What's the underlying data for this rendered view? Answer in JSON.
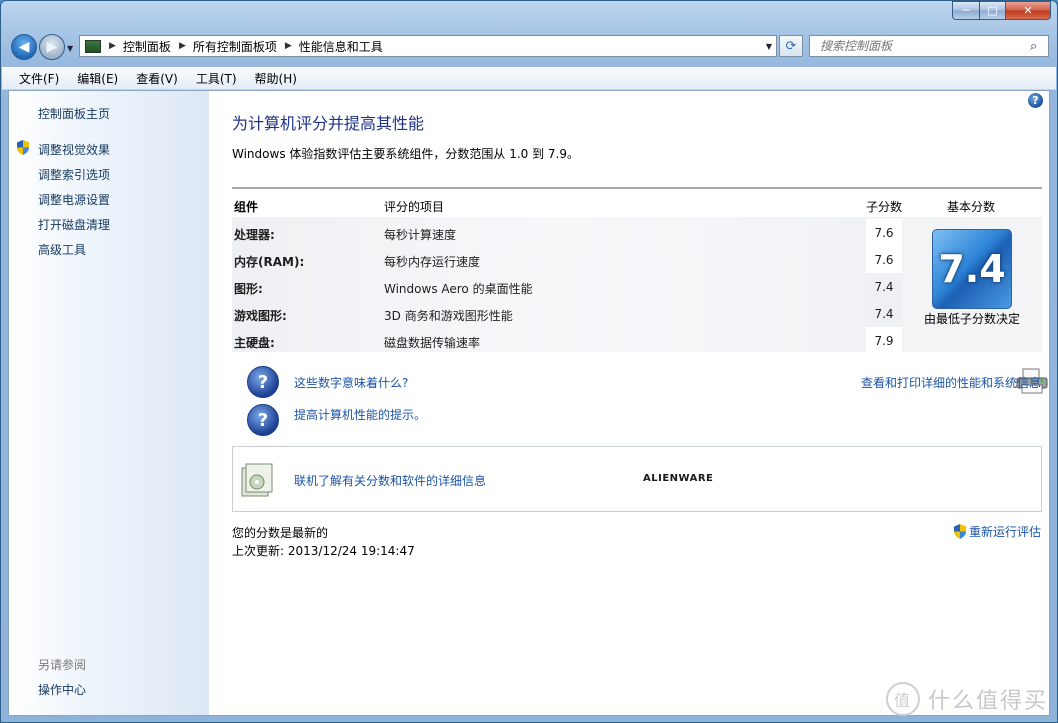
{
  "window": {
    "controls": {
      "minimize": "─",
      "maximize": "□",
      "close": "✕"
    }
  },
  "address": {
    "breadcrumbs": [
      "控制面板",
      "所有控制面板项",
      "性能信息和工具"
    ],
    "search_placeholder": "搜索控制面板"
  },
  "menu": [
    "文件(F)",
    "编辑(E)",
    "查看(V)",
    "工具(T)",
    "帮助(H)"
  ],
  "sidebar": {
    "home": "控制面板主页",
    "links": [
      "调整视觉效果",
      "调整索引选项",
      "调整电源设置",
      "打开磁盘清理",
      "高级工具"
    ],
    "see_also_heading": "另请参阅",
    "see_also_links": [
      "操作中心"
    ]
  },
  "main": {
    "title": "为计算机评分并提高其性能",
    "description": "Windows 体验指数评估主要系统组件，分数范围从 1.0 到 7.9。",
    "table": {
      "headers": {
        "component": "组件",
        "rated_item": "评分的项目",
        "subscore": "子分数",
        "base_score": "基本分数"
      },
      "rows": [
        {
          "component": "处理器:",
          "item": "每秒计算速度",
          "score": "7.6"
        },
        {
          "component": "内存(RAM):",
          "item": "每秒内存运行速度",
          "score": "7.6"
        },
        {
          "component": "图形:",
          "item": "Windows Aero 的桌面性能",
          "score": "7.4"
        },
        {
          "component": "游戏图形:",
          "item": "3D 商务和游戏图形性能",
          "score": "7.4"
        },
        {
          "component": "主硬盘:",
          "item": "磁盘数据传输速率",
          "score": "7.9"
        }
      ],
      "base_score": "7.4",
      "base_caption": "由最低子分数决定"
    },
    "links": {
      "what_mean": "这些数字意味着什么?",
      "tips": "提高计算机性能的提示。",
      "print_details": "查看和打印详细的性能和系统信息",
      "online": "联机了解有关分数和软件的详细信息"
    },
    "brand": "ALIENWARE",
    "status": {
      "current": "您的分数是最新的",
      "last_update": "上次更新: 2013/12/24 19:14:47",
      "rerun": "重新运行评估"
    },
    "help_glyph": "?"
  },
  "watermark": {
    "text": "什么值得买",
    "icon_glyph": "值"
  }
}
